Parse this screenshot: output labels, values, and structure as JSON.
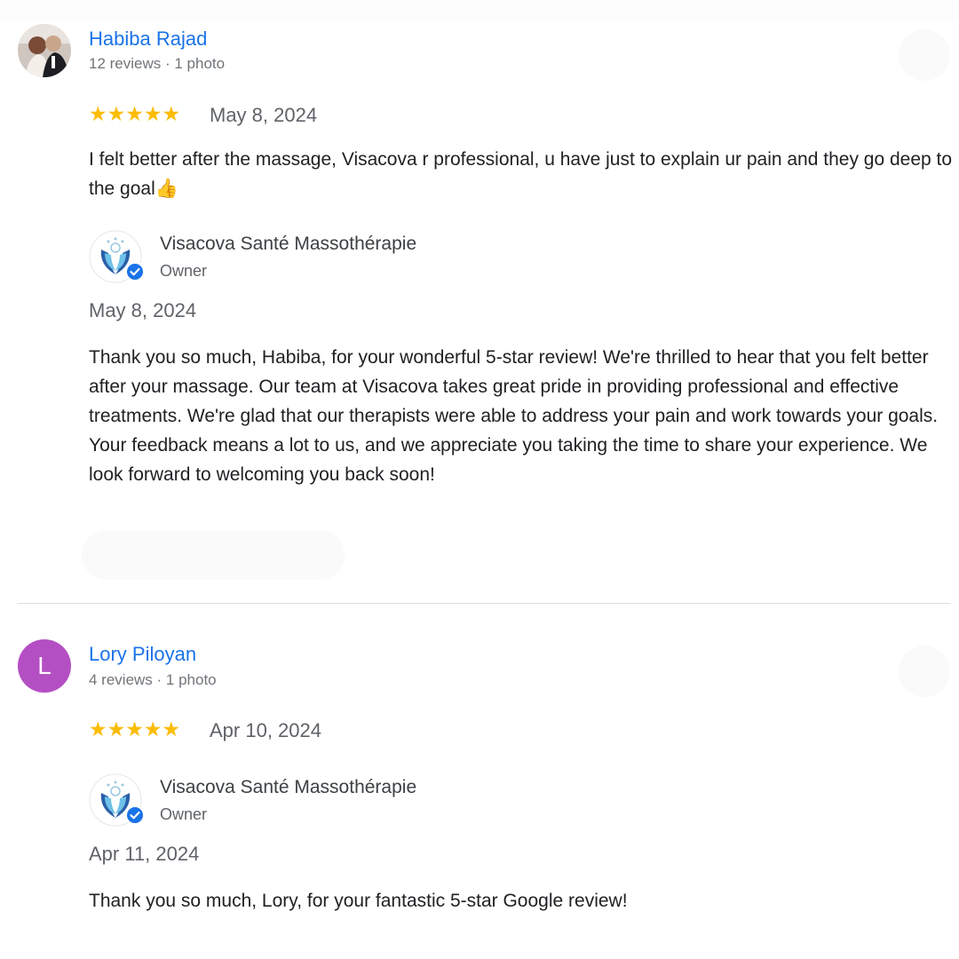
{
  "reviews": [
    {
      "reviewer_name": "Habiba Rajad",
      "reviewer_meta": "12 reviews · 1 photo",
      "avatar": "photo",
      "rating": 5,
      "stars": "★★★★★",
      "date": "May 8, 2024",
      "text": "I felt better after the massage, Visacova r professional, u have just to explain ur pain and they go deep to the goal👍",
      "reply": {
        "owner_name": "Visacova Santé Massothérapie",
        "owner_role": "Owner",
        "date": "May 8, 2024",
        "text": "Thank you so much, Habiba, for your wonderful 5-star review! We're thrilled to hear that you felt better after your massage. Our team at Visacova takes great pride in providing professional and effective treatments. We're glad that our therapists were able to address your pain and work towards your goals. Your feedback means a lot to us, and we appreciate you taking the time to share your experience. We look forward to welcoming you back soon!"
      }
    },
    {
      "reviewer_name": "Lory Piloyan",
      "reviewer_meta": "4 reviews · 1 photo",
      "avatar": "letter",
      "avatar_letter": "L",
      "avatar_color": "#b44fc3",
      "rating": 5,
      "stars": "★★★★★",
      "date": "Apr 10, 2024",
      "reply": {
        "owner_name": "Visacova Santé Massothérapie",
        "owner_role": "Owner",
        "date": "Apr 11, 2024",
        "text": "Thank you so much, Lory, for your fantastic 5-star Google review!"
      }
    }
  ],
  "colors": {
    "link_blue": "#1a73e8",
    "star_yellow": "#fbbc04",
    "verified_blue": "#1a73e8"
  },
  "icons": [
    "more-options-icon",
    "verified-badge-icon",
    "star-icon"
  ]
}
